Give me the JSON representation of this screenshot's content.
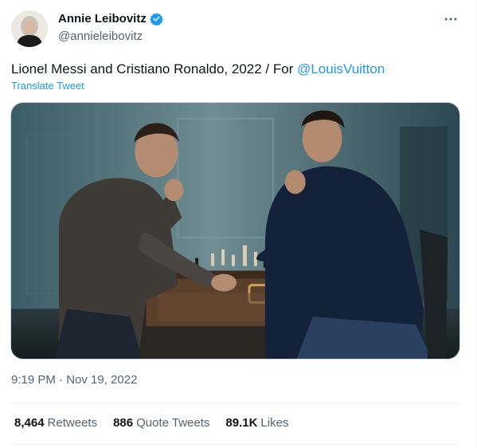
{
  "author": {
    "name": "Annie Leibovitz",
    "handle": "@annieleibovitz",
    "verified": true,
    "avatar_icon": "avatar-portrait"
  },
  "tweet": {
    "text_prefix": "Lionel Messi and Cristiano Ronaldo, 2022 / For ",
    "mention": "@LouisVuitton",
    "translate_label": "Translate Tweet",
    "timestamp": "9:19 PM · Nov 19, 2022"
  },
  "stats": {
    "retweets_count": "8,464",
    "retweets_label": "Retweets",
    "quotes_count": "886",
    "quotes_label": "Quote Tweets",
    "likes_count": "89.1K",
    "likes_label": "Likes"
  },
  "colors": {
    "accent": "#1d9bf0",
    "text_primary": "#0f1419",
    "text_secondary": "#536471",
    "divider": "#eff3f4"
  },
  "icons": {
    "more": "more-horizontal-icon",
    "verified": "verified-badge-icon"
  }
}
